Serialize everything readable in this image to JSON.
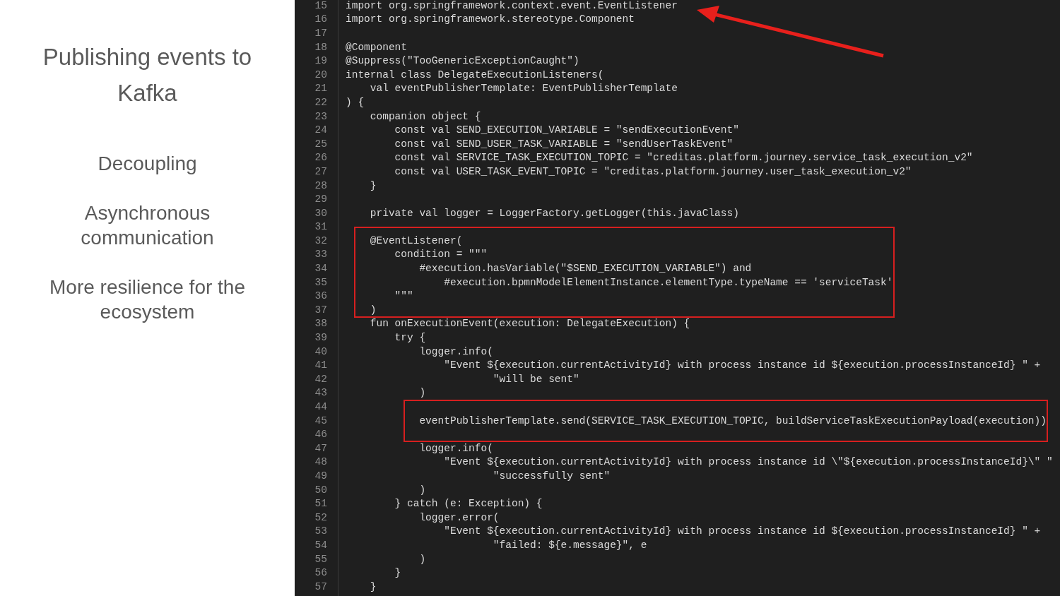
{
  "slide": {
    "title": "Publishing events to Kafka",
    "points": [
      "Decoupling",
      "Asynchronous communication",
      "More resilience for the ecosystem"
    ]
  },
  "editor": {
    "lines": [
      {
        "number": "15",
        "text": "import org.springframework.context.event.EventListener",
        "boxed": false
      },
      {
        "number": "16",
        "text": "import org.springframework.stereotype.Component",
        "boxed": false
      },
      {
        "number": "17",
        "boxed": false
      },
      {
        "number": "18",
        "text": "@Component",
        "boxed": false
      },
      {
        "number": "19",
        "text": "@Suppress(\"TooGenericExceptionCaught\")",
        "boxed": false
      },
      {
        "number": "20",
        "text": "internal class DelegateExecutionListeners(",
        "boxed": false
      },
      {
        "number": "21",
        "text": "    val eventPublisherTemplate: EventPublisherTemplate",
        "boxed": false
      },
      {
        "number": "22",
        "text": ") {",
        "boxed": false
      },
      {
        "number": "23",
        "text": "    companion object {",
        "boxed": false
      },
      {
        "number": "24",
        "text": "        const val SEND_EXECUTION_VARIABLE = \"sendExecutionEvent\"",
        "boxed": false
      },
      {
        "number": "25",
        "text": "        const val SEND_USER_TASK_VARIABLE = \"sendUserTaskEvent\"",
        "boxed": false
      },
      {
        "number": "26",
        "text": "        const val SERVICE_TASK_EXECUTION_TOPIC = \"creditas.platform.journey.service_task_execution_v2\"",
        "boxed": false
      },
      {
        "number": "27",
        "text": "        const val USER_TASK_EVENT_TOPIC = \"creditas.platform.journey.user_task_execution_v2\"",
        "boxed": false
      },
      {
        "number": "28",
        "text": "    }",
        "boxed": false
      },
      {
        "number": "29",
        "boxed": false
      },
      {
        "number": "30",
        "text": "    private val logger = LoggerFactory.getLogger(this.javaClass)",
        "boxed": false
      },
      {
        "number": "31",
        "boxed": false
      },
      {
        "number": "32",
        "text": "    @EventListener(",
        "boxed": true
      },
      {
        "number": "33",
        "text": "        condition = \"\"\"",
        "boxed": true
      },
      {
        "number": "34",
        "text": "            #execution.hasVariable(\"$SEND_EXECUTION_VARIABLE\") and",
        "boxed": true
      },
      {
        "number": "35",
        "text": "                #execution.bpmnModelElementInstance.elementType.typeName == 'serviceTask'",
        "boxed": true
      },
      {
        "number": "36",
        "text": "        \"\"\"",
        "boxed": true
      },
      {
        "number": "37",
        "text": "    )",
        "boxed": true
      },
      {
        "number": "38",
        "text": "    fun onExecutionEvent(execution: DelegateExecution) {",
        "boxed": false
      },
      {
        "number": "39",
        "text": "        try {",
        "boxed": false
      },
      {
        "number": "40",
        "text": "            logger.info(",
        "boxed": false
      },
      {
        "number": "41",
        "text": "                \"Event ${execution.currentActivityId} with process instance id ${execution.processInstanceId} \" +",
        "boxed": false
      },
      {
        "number": "42",
        "text": "                        \"will be sent\"",
        "boxed": false
      },
      {
        "number": "43",
        "text": "            )",
        "boxed": false
      },
      {
        "number": "44",
        "boxed": true
      },
      {
        "number": "45",
        "text": "            eventPublisherTemplate.send(SERVICE_TASK_EXECUTION_TOPIC, buildServiceTaskExecutionPayload(execution))",
        "boxed": true
      },
      {
        "number": "46",
        "boxed": true
      },
      {
        "number": "47",
        "text": "            logger.info(",
        "boxed": false
      },
      {
        "number": "48",
        "text": "                \"Event ${execution.currentActivityId} with process instance id \\\"${execution.processInstanceId}\\\" \"",
        "boxed": false
      },
      {
        "number": "49",
        "text": "                        \"successfully sent\"",
        "boxed": false
      },
      {
        "number": "50",
        "text": "            )",
        "boxed": false
      },
      {
        "number": "51",
        "text": "        } catch (e: Exception) {",
        "boxed": false
      },
      {
        "number": "52",
        "text": "            logger.error(",
        "boxed": false
      },
      {
        "number": "53",
        "text": "                \"Event ${execution.currentActivityId} with process instance id ${execution.processInstanceId} \" +",
        "boxed": false
      },
      {
        "number": "54",
        "text": "                        \"failed: ${e.message}\", e",
        "boxed": false
      },
      {
        "number": "55",
        "text": "            )",
        "boxed": false
      },
      {
        "number": "56",
        "text": "        }",
        "boxed": false
      },
      {
        "number": "57",
        "text": "    }",
        "boxed": false
      }
    ]
  }
}
